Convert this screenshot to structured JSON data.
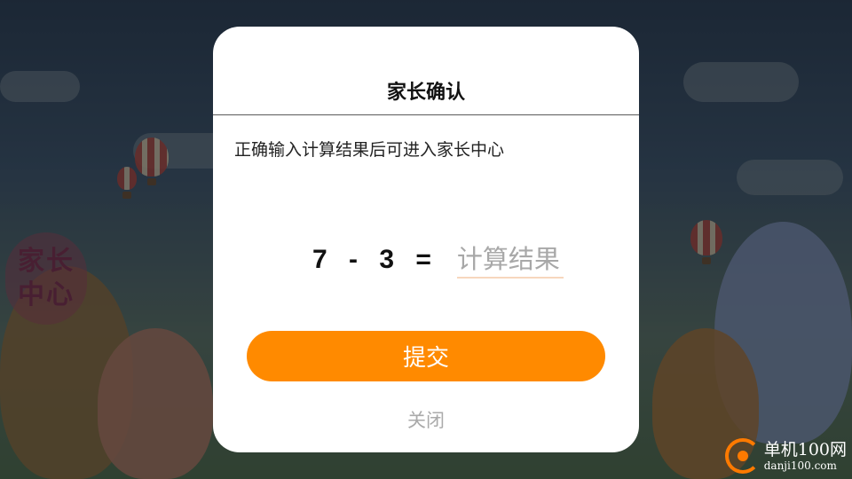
{
  "background": {
    "badge_line1": "家长",
    "badge_line2": "中心"
  },
  "dialog": {
    "title": "家长确认",
    "instruction": "正确输入计算结果后可进入家长中心",
    "equation": "7 - 3 =",
    "answer_placeholder": "计算结果",
    "answer_value": "",
    "submit_label": "提交",
    "close_label": "关闭"
  },
  "watermark": {
    "name": "单机100网",
    "url": "danji100.com"
  },
  "colors": {
    "accent": "#ff8a00",
    "input_underline": "#f7d7bd",
    "close_text": "#aaaaaa"
  }
}
